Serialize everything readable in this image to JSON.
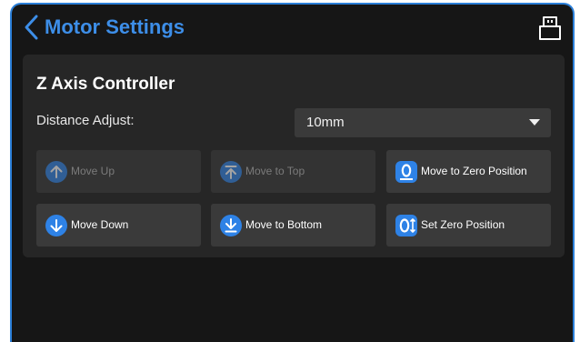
{
  "header": {
    "title": "Motor Settings",
    "back_icon": "chevron-left-icon",
    "printer_icon": "printer-icon"
  },
  "panel": {
    "title": "Z Axis Controller",
    "distance_label": "Distance Adjust:",
    "distance_value": "10mm",
    "buttons": {
      "move_up": "Move Up",
      "move_to_top": "Move to Top",
      "move_to_zero": "Move to Zero Position",
      "move_down": "Move Down",
      "move_to_bottom": "Move to Bottom",
      "set_zero": "Set Zero Position"
    }
  },
  "colors": {
    "accent": "#2b7fd8",
    "icon_blue": "#2e82e6",
    "panel_bg": "#262626",
    "screen_bg": "#161616",
    "button_bg": "#3a3a3a"
  }
}
